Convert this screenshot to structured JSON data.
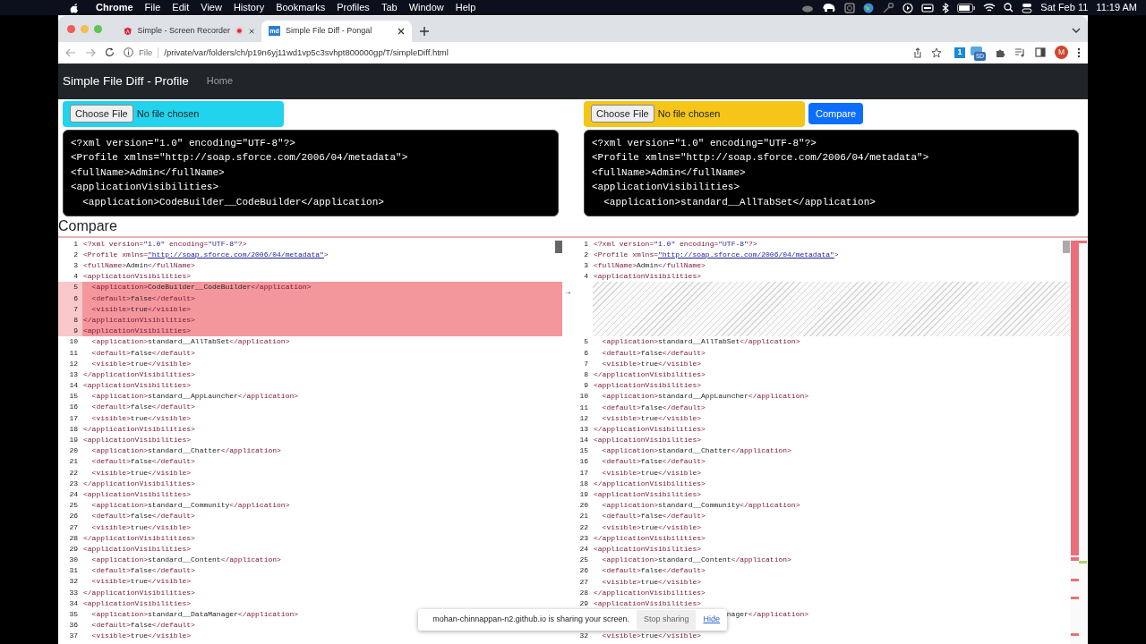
{
  "menu_bar": {
    "app": "Chrome",
    "menus": [
      "File",
      "Edit",
      "View",
      "History",
      "Bookmarks",
      "Profiles",
      "Tab",
      "Window",
      "Help"
    ],
    "date": "Sat Feb 11",
    "time": "11:19 AM"
  },
  "tabs": [
    {
      "title": "Simple - Screen Recorder",
      "selected": false,
      "recording": true
    },
    {
      "title": "Simple File Diff - Pongal",
      "selected": true,
      "favicon_text": "md"
    }
  ],
  "address_bar": {
    "scheme": "File",
    "url": "/private/var/folders/ch/p19n6yj11wd1vp5c3svhpt800000gp/T/simpleDiff.html"
  },
  "toolbar": {
    "password_badge": "1",
    "sd_badge": "SD",
    "avatar": "M"
  },
  "navbar": {
    "brand": "Simple File Diff - Profile",
    "links": [
      "Home"
    ]
  },
  "inputs": [
    {
      "color": "#22d3ee",
      "button": "Choose File",
      "status": "No file chosen",
      "lines": [
        "<?xml version=\"1.0\" encoding=\"UTF-8\"?>",
        "<Profile xmlns=\"http://soap.sforce.com/2006/04/metadata\">",
        "<fullName>Admin</fullName>",
        "<applicationVisibilities>",
        "  <application>CodeBuilder__CodeBuilder</application>"
      ]
    },
    {
      "color": "#f5c518",
      "button": "Choose File",
      "status": "No file chosen",
      "lines": [
        "<?xml version=\"1.0\" encoding=\"UTF-8\"?>",
        "<Profile xmlns=\"http://soap.sforce.com/2006/04/metadata\">",
        "<fullName>Admin</fullName>",
        "<applicationVisibilities>",
        "  <application>standard__AllTabSet</application>"
      ]
    }
  ],
  "compare_button": "Compare",
  "compare": {
    "heading": "Compare",
    "merge_arrow": "→",
    "left": [
      {
        "num": "1",
        "text": "<?xml version=\"1.0\" encoding=\"UTF-8\"?>",
        "kind": "same"
      },
      {
        "num": "2",
        "text": "<Profile xmlns=\"http://soap.sforce.com/2006/04/metadata\">",
        "kind": "same"
      },
      {
        "num": "3",
        "text": "<fullName>Admin</fullName>",
        "kind": "same"
      },
      {
        "num": "4",
        "text": "<applicationVisibilities>",
        "kind": "same"
      },
      {
        "num": "5",
        "text": "  <application>CodeBuilder__CodeBuilder</application>",
        "kind": "removed"
      },
      {
        "num": "6",
        "text": "  <default>false</default>",
        "kind": "removed"
      },
      {
        "num": "7",
        "text": "  <visible>true</visible>",
        "kind": "removed"
      },
      {
        "num": "8",
        "text": "</applicationVisibilities>",
        "kind": "removed"
      },
      {
        "num": "9",
        "text": "<applicationVisibilities>",
        "kind": "removed"
      },
      {
        "num": "10",
        "text": "  <application>standard__AllTabSet</application>",
        "kind": "same"
      },
      {
        "num": "11",
        "text": "  <default>false</default>",
        "kind": "same"
      },
      {
        "num": "12",
        "text": "  <visible>true</visible>",
        "kind": "same"
      },
      {
        "num": "13",
        "text": "</applicationVisibilities>",
        "kind": "same"
      },
      {
        "num": "14",
        "text": "<applicationVisibilities>",
        "kind": "same"
      },
      {
        "num": "15",
        "text": "  <application>standard__AppLauncher</application>",
        "kind": "same"
      },
      {
        "num": "16",
        "text": "  <default>false</default>",
        "kind": "same"
      },
      {
        "num": "17",
        "text": "  <visible>true</visible>",
        "kind": "same"
      },
      {
        "num": "18",
        "text": "</applicationVisibilities>",
        "kind": "same"
      },
      {
        "num": "19",
        "text": "<applicationVisibilities>",
        "kind": "same"
      },
      {
        "num": "20",
        "text": "  <application>standard__Chatter</application>",
        "kind": "same"
      },
      {
        "num": "21",
        "text": "  <default>false</default>",
        "kind": "same"
      },
      {
        "num": "22",
        "text": "  <visible>true</visible>",
        "kind": "same"
      },
      {
        "num": "23",
        "text": "</applicationVisibilities>",
        "kind": "same"
      },
      {
        "num": "24",
        "text": "<applicationVisibilities>",
        "kind": "same"
      },
      {
        "num": "25",
        "text": "  <application>standard__Community</application>",
        "kind": "same"
      },
      {
        "num": "26",
        "text": "  <default>false</default>",
        "kind": "same"
      },
      {
        "num": "27",
        "text": "  <visible>true</visible>",
        "kind": "same"
      },
      {
        "num": "28",
        "text": "</applicationVisibilities>",
        "kind": "same"
      },
      {
        "num": "29",
        "text": "<applicationVisibilities>",
        "kind": "same"
      },
      {
        "num": "30",
        "text": "  <application>standard__Content</application>",
        "kind": "same"
      },
      {
        "num": "31",
        "text": "  <default>false</default>",
        "kind": "same"
      },
      {
        "num": "32",
        "text": "  <visible>true</visible>",
        "kind": "same"
      },
      {
        "num": "33",
        "text": "</applicationVisibilities>",
        "kind": "same"
      },
      {
        "num": "34",
        "text": "<applicationVisibilities>",
        "kind": "same"
      },
      {
        "num": "35",
        "text": "  <application>standard__DataManager</application>",
        "kind": "same"
      },
      {
        "num": "36",
        "text": "  <default>false</default>",
        "kind": "same"
      },
      {
        "num": "37",
        "text": "  <visible>true</visible>",
        "kind": "same"
      }
    ],
    "right": [
      {
        "num": "1",
        "text": "<?xml version=\"1.0\" encoding=\"UTF-8\"?>",
        "kind": "same"
      },
      {
        "num": "2",
        "text": "<Profile xmlns=\"http://soap.sforce.com/2006/04/metadata\">",
        "kind": "same"
      },
      {
        "num": "3",
        "text": "<fullName>Admin</fullName>",
        "kind": "same"
      },
      {
        "num": "4",
        "text": "<applicationVisibilities>",
        "kind": "same"
      },
      {
        "kind": "filler"
      },
      {
        "kind": "filler"
      },
      {
        "kind": "filler"
      },
      {
        "kind": "filler"
      },
      {
        "kind": "filler"
      },
      {
        "num": "5",
        "text": "  <application>standard__AllTabSet</application>",
        "kind": "same"
      },
      {
        "num": "6",
        "text": "  <default>false</default>",
        "kind": "same"
      },
      {
        "num": "7",
        "text": "  <visible>true</visible>",
        "kind": "same"
      },
      {
        "num": "8",
        "text": "</applicationVisibilities>",
        "kind": "same"
      },
      {
        "num": "9",
        "text": "<applicationVisibilities>",
        "kind": "same"
      },
      {
        "num": "10",
        "text": "  <application>standard__AppLauncher</application>",
        "kind": "same"
      },
      {
        "num": "11",
        "text": "  <default>false</default>",
        "kind": "same"
      },
      {
        "num": "12",
        "text": "  <visible>true</visible>",
        "kind": "same"
      },
      {
        "num": "13",
        "text": "</applicationVisibilities>",
        "kind": "same"
      },
      {
        "num": "14",
        "text": "<applicationVisibilities>",
        "kind": "same"
      },
      {
        "num": "15",
        "text": "  <application>standard__Chatter</application>",
        "kind": "same"
      },
      {
        "num": "16",
        "text": "  <default>false</default>",
        "kind": "same"
      },
      {
        "num": "17",
        "text": "  <visible>true</visible>",
        "kind": "same"
      },
      {
        "num": "18",
        "text": "</applicationVisibilities>",
        "kind": "same"
      },
      {
        "num": "19",
        "text": "<applicationVisibilities>",
        "kind": "same"
      },
      {
        "num": "20",
        "text": "  <application>standard__Community</application>",
        "kind": "same"
      },
      {
        "num": "21",
        "text": "  <default>false</default>",
        "kind": "same"
      },
      {
        "num": "22",
        "text": "  <visible>true</visible>",
        "kind": "same"
      },
      {
        "num": "23",
        "text": "</applicationVisibilities>",
        "kind": "same"
      },
      {
        "num": "24",
        "text": "<applicationVisibilities>",
        "kind": "same"
      },
      {
        "num": "25",
        "text": "  <application>standard__Content</application>",
        "kind": "same"
      },
      {
        "num": "26",
        "text": "  <default>false</default>",
        "kind": "same"
      },
      {
        "num": "27",
        "text": "  <visible>true</visible>",
        "kind": "same"
      },
      {
        "num": "28",
        "text": "</applicationVisibilities>",
        "kind": "same"
      },
      {
        "num": "29",
        "text": "<applicationVisibilities>",
        "kind": "same"
      },
      {
        "text": "nager</application>",
        "kind": "covered"
      },
      {
        "kind": "covered"
      },
      {
        "num": "32",
        "text": "  <visible>true</visible>",
        "kind": "same"
      }
    ]
  },
  "share_notice": {
    "message": "mohan-chinnappan-n2.github.io is sharing your screen.",
    "stop": "Stop sharing",
    "hide": "Hide"
  }
}
